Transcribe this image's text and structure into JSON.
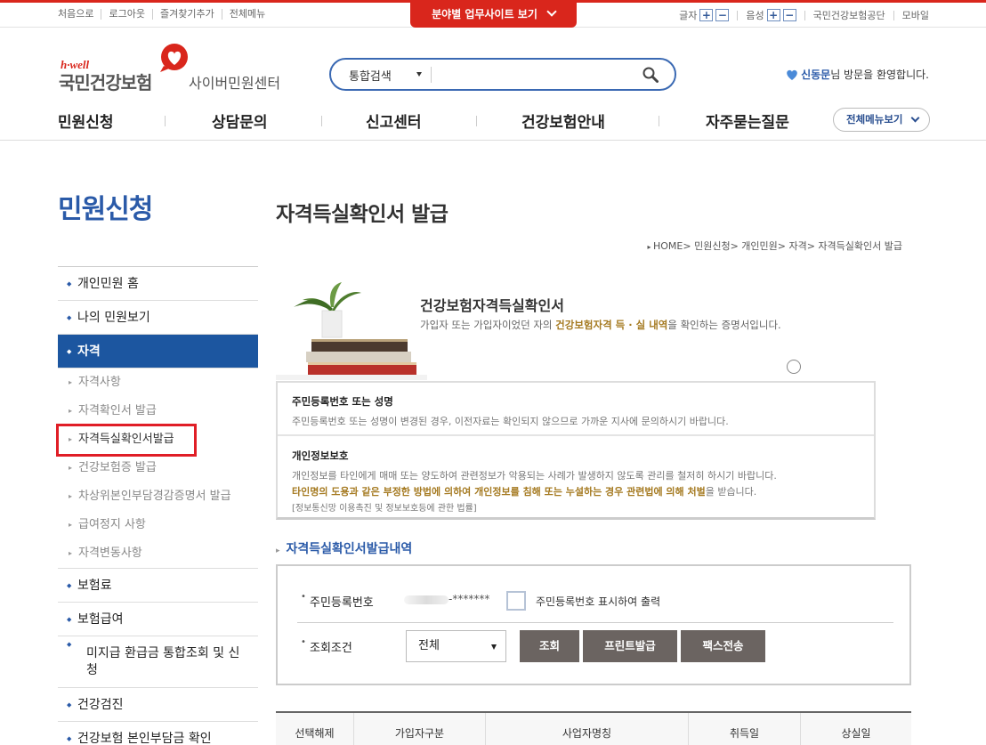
{
  "util_left": [
    "처음으로",
    "로그아웃",
    "즐겨찾기추가",
    "전체메뉴"
  ],
  "site_tab": "분야별 업무사이트 보기",
  "util_right": {
    "font_label": "글자",
    "voice_label": "음성",
    "org": "국민건강보험공단",
    "mobile": "모바일",
    "plus": "+",
    "minus": "−"
  },
  "logo": {
    "tagline": "h·well",
    "name": "국민건강보험",
    "sub": "사이버민원센터"
  },
  "search": {
    "scope": "통합검색",
    "placeholder": ""
  },
  "welcome": {
    "user": "신동문",
    "suffix": "님 방문을 환영합니다."
  },
  "gnb": [
    "민원신청",
    "상담문의",
    "신고센터",
    "건강보험안내",
    "자주묻는질문"
  ],
  "all_menu": "전체메뉴보기",
  "sidebar": {
    "title": "민원신청",
    "d1_a": "개인민원 홈",
    "d1_b": "나의 민원보기",
    "d1_active": "자격",
    "sub": [
      "자격사항",
      "자격확인서 발급",
      "자격득실확인서발급",
      "건강보험증 발급",
      "차상위본인부담경감증명서 발급",
      "급여정지 사항",
      "자격변동사항"
    ],
    "d1_after": [
      "보험료",
      "보험급여",
      "미지급 환급금 통합조회 및 신청",
      "건강검진",
      "건강보험 본인부담금 확인"
    ]
  },
  "content": {
    "title": "자격득실확인서 발급",
    "breadcrumb": "HOME> 민원신청> 개인민원> 자격> 자격득실확인서 발급",
    "hero_title": "건강보험자격득실확인서",
    "hero_desc_pre": "가입자 또는 가입자이었던 자의 ",
    "hero_desc_hl": "건강보험자격 득 · 실 내역",
    "hero_desc_post": "을 확인하는 증명서입니다.",
    "notice1_title": "주민등록번호 또는 성명",
    "notice1_text": "주민등록번호 또는 성명이 변경된 경우, 이전자료는 확인되지 않으므로 가까운 지사에 문의하시기 바랍니다.",
    "notice2_title": "개인정보보호",
    "notice2_text": "개인정보를 타인에게 매매 또는 양도하여 관련정보가 악용되는 사례가 발생하지 않도록 관리를 철저히 하시기 바랍니다.",
    "notice2_warn_hl": "타인명의 도용과 같은 부정한 방법에 의하여 개인정보를 침해 또는 누설하는 경우 관련법에 의해 처벌",
    "notice2_warn_post": "을 받습니다.",
    "notice2_law": "[정보통신망 이용촉진 및 정보보호등에 관한 법률]",
    "section": "자격득실확인서발급내역"
  },
  "form": {
    "rrn_label": "주민등록번호",
    "rrn_masked": "-*******",
    "show_rrn_label": "주민등록번호 표시하여 출력",
    "cond_label": "조회조건",
    "cond_value": "전체",
    "btn_search": "조회",
    "btn_print": "프린트발급",
    "btn_fax": "팩스전송"
  },
  "table_headers": [
    "선택해제",
    "가입자구분",
    "사업자명칭",
    "취득일",
    "상실일"
  ],
  "colors": {
    "brand_red": "#d9261c",
    "brand_blue": "#2a5aa8",
    "active_blue": "#1c56a0",
    "highlight_gold": "#a57a21",
    "button_gray": "#6b6461"
  }
}
